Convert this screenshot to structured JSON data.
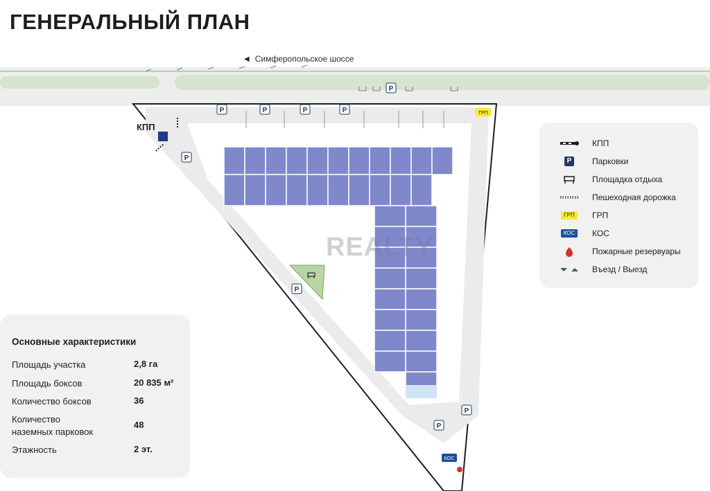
{
  "title": "ГЕНЕРАЛЬНЫЙ ПЛАН",
  "road": {
    "name": "Симферопольское шоссе",
    "direction_icon": "arrow-left-icon"
  },
  "map_labels": {
    "kpp": "КПП",
    "grp": "ГРП",
    "kos": "КОС",
    "parking": "P"
  },
  "watermark": "REALTY",
  "legend": {
    "items": [
      {
        "icon": "barrier-icon",
        "label": "КПП"
      },
      {
        "icon": "parking-icon",
        "badge": "P",
        "label": "Парковки"
      },
      {
        "icon": "bench-icon",
        "label": "Площадка отдыха"
      },
      {
        "icon": "walkway-icon",
        "label": "Пешеходная дорожка"
      },
      {
        "icon": "grp-badge",
        "badge": "ГРП",
        "label": "ГРП"
      },
      {
        "icon": "kos-badge",
        "badge": "КОС",
        "label": "КОС"
      },
      {
        "icon": "fire-reservoir-icon",
        "label": "Пожарные резервуары"
      },
      {
        "icon": "entry-exit-arrows-icon",
        "label": "Въезд / Выезд"
      }
    ]
  },
  "stats": {
    "heading": "Основные характеристики",
    "rows": [
      {
        "label": "Площадь участка",
        "value": "2,8 га"
      },
      {
        "label": "Площадь боксов",
        "value": "20 835 м²"
      },
      {
        "label": "Количество боксов",
        "value": "36"
      },
      {
        "label_line1": "Количество",
        "label_line2": "наземных парковок",
        "value": "48"
      },
      {
        "label": "Этажность",
        "value": "2 эт."
      }
    ]
  },
  "colors": {
    "road_green": "#d6e3cf",
    "asphalt": "#e4e4e4",
    "building": "#8088cc",
    "building_stroke": "#ffffff",
    "rest_area": "#b9d5a3",
    "parking_badge": "#1f3a5a",
    "grp_yellow": "#f6ea34",
    "kos_blue": "#1d4f9c",
    "fire_red": "#d9302c"
  }
}
